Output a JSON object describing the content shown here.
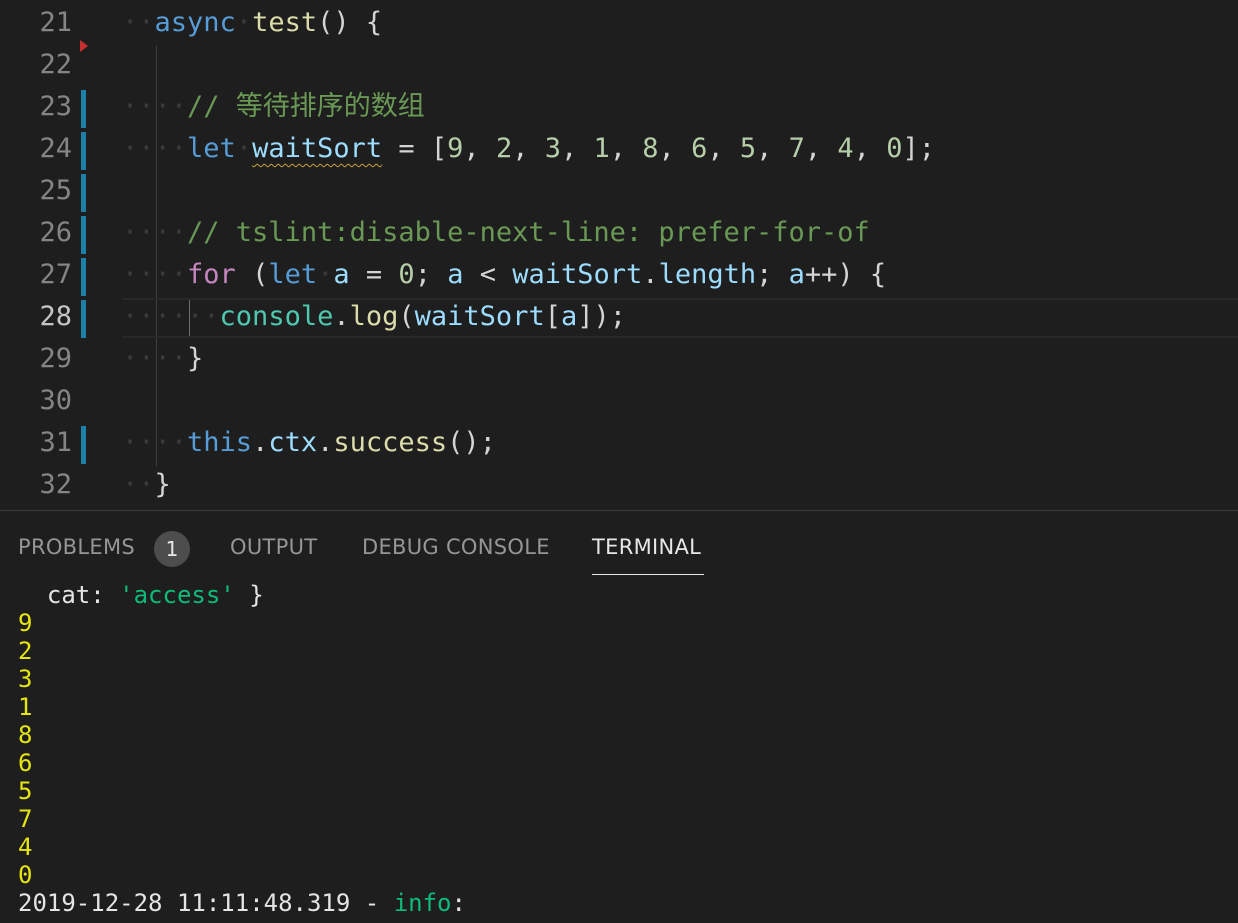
{
  "editor": {
    "lines": [
      {
        "num": "21"
      },
      {
        "num": "22"
      },
      {
        "num": "23"
      },
      {
        "num": "24"
      },
      {
        "num": "25"
      },
      {
        "num": "26"
      },
      {
        "num": "27"
      },
      {
        "num": "28"
      },
      {
        "num": "29"
      },
      {
        "num": "30"
      },
      {
        "num": "31"
      },
      {
        "num": "32"
      }
    ],
    "code": {
      "l21_async": "async",
      "l21_fn": "test",
      "l21_rest": "() {",
      "l23_comment": "// 等待排序的数组",
      "l24_let": "let",
      "l24_var": "waitSort",
      "l24_eq": " = [",
      "l24_nums": [
        "9",
        "2",
        "3",
        "1",
        "8",
        "6",
        "5",
        "7",
        "4",
        "0"
      ],
      "l24_end": "];",
      "l26_comment": "// tslint:disable-next-line: prefer-for-of",
      "l27_for": "for",
      "l27_open": " (",
      "l27_let": "let",
      "l27_a": "a",
      "l27_eq": " = ",
      "l27_zero": "0",
      "l27_semi": "; ",
      "l27_a2": "a",
      "l27_lt": " < ",
      "l27_ws": "waitSort",
      "l27_dot": ".",
      "l27_len": "length",
      "l27_semi2": "; ",
      "l27_a3": "a",
      "l27_pp": "++) {",
      "l28_console": "console",
      "l28_dot": ".",
      "l28_log": "log",
      "l28_open": "(",
      "l28_ws": "waitSort",
      "l28_br": "[",
      "l28_a": "a",
      "l28_end": "]);",
      "l29_close": "}",
      "l31_this": "this",
      "l31_dot": ".",
      "l31_ctx": "ctx",
      "l31_dot2": ".",
      "l31_succ": "success",
      "l31_end": "();",
      "l32_close": "}"
    }
  },
  "panel": {
    "tabs": {
      "problems": "PROBLEMS",
      "problems_count": "1",
      "output": "OUTPUT",
      "debug": "DEBUG CONSOLE",
      "terminal": "TERMINAL"
    },
    "terminal": {
      "cat_key": "  cat: ",
      "cat_val": "'access'",
      "cat_close": " }",
      "outputs": [
        "9",
        "2",
        "3",
        "1",
        "8",
        "6",
        "5",
        "7",
        "4",
        "0"
      ],
      "log_time": "2019-12-28 11:11:48.319 - ",
      "log_level": "info",
      "log_colon": ":"
    }
  },
  "colors": {
    "accent": "#1b81a8",
    "keyword": "#569cd6",
    "function": "#dcdcaa",
    "comment": "#6a9955",
    "terminal_number": "#e5e510"
  }
}
